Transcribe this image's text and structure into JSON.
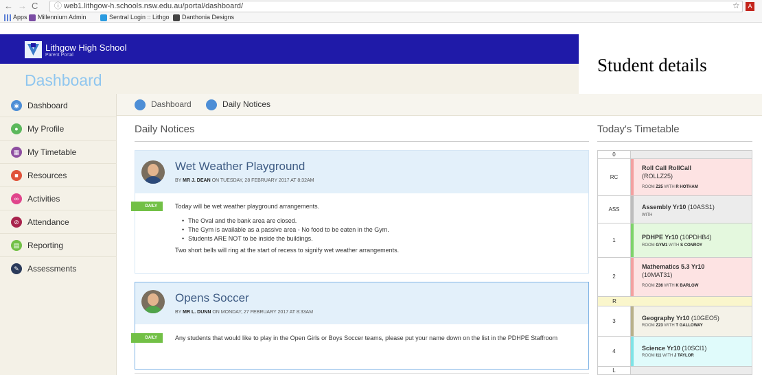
{
  "browser": {
    "url": "web1.lithgow-h.schools.nsw.edu.au/portal/dashboard/",
    "bookmarks": [
      "Apps",
      "Millennium Admin",
      "Sentral Login :: Lithgo",
      "Danthonia Designs"
    ]
  },
  "header": {
    "school": "Lithgow High School",
    "portal": "Parent Portal",
    "page_title": "Dashboard",
    "overlay_label": "Student details"
  },
  "sidebar": {
    "items": [
      {
        "label": "Dashboard",
        "color": "#4d8ed6"
      },
      {
        "label": "My Profile",
        "color": "#5cb85c"
      },
      {
        "label": "My Timetable",
        "color": "#8e4ea0"
      },
      {
        "label": "Resources",
        "color": "#e0533a"
      },
      {
        "label": "Activities",
        "color": "#e0458c"
      },
      {
        "label": "Attendance",
        "color": "#a8234c"
      },
      {
        "label": "Reporting",
        "color": "#72c046"
      },
      {
        "label": "Assessments",
        "color": "#2a3a5a"
      }
    ]
  },
  "breadcrumbs": [
    "Dashboard",
    "Daily Notices"
  ],
  "main": {
    "notices_title": "Daily Notices",
    "notices": [
      {
        "title": "Wet Weather Playground",
        "by_prefix": "BY",
        "author": "MR J. DEAN",
        "date": "ON TUESDAY, 28 FEBRUARY 2017 AT 8:32AM",
        "flag": "DAILY",
        "lead": "Today will be wet weather playground arrangements.",
        "bullets": [
          "The Oval and the bank area are closed.",
          "The Gym is available as a passive area - No food to be eaten in the Gym.",
          "Students ARE NOT to be inside the buildings."
        ],
        "tail": "Two short bells will ring at the start of recess to signify wet weather arrangements."
      },
      {
        "title": "Opens Soccer",
        "by_prefix": "BY",
        "author": "MR L. DUNN",
        "date": "ON MONDAY, 27 FEBRUARY 2017 AT 8:33AM",
        "flag": "DAILY",
        "lead": "Any students that would like to play in the Open Girls or Boys Soccer teams, please put your name down on the list in the PDHPE Staffroom"
      }
    ]
  },
  "timetable": {
    "title": "Today's Timetable",
    "rows": [
      {
        "period": "0"
      },
      {
        "period": "RC",
        "subject": "Roll Call RollCall",
        "code": "(ROLLZ25)",
        "room_prefix": "ROOM",
        "room": "Z25",
        "with": "WITH",
        "teacher": "R HOTHAM",
        "color": "#fde3e3",
        "bar": "#f3a0a0"
      },
      {
        "period": "ASS",
        "subject": "Assembly Yr10",
        "code": "(10ASS1)",
        "with": "WITH",
        "color": "#ececec",
        "bar": "#bdbdbd"
      },
      {
        "period": "1",
        "subject": "PDHPE Yr10",
        "code": "(10PDHB4)",
        "room_prefix": "ROOM",
        "room": "GYM1",
        "with": "WITH",
        "teacher": "S CONROY",
        "color": "#e4f8de",
        "bar": "#7ed36a"
      },
      {
        "period": "2",
        "subject": "Mathematics 5.3 Yr10",
        "code": "(10MAT31)",
        "room_prefix": "ROOM",
        "room": "Z36",
        "with": "WITH",
        "teacher": "K BARLOW",
        "color": "#fde3e3",
        "bar": "#f3a0a0"
      },
      {
        "period": "R"
      },
      {
        "period": "3",
        "subject": "Geography Yr10",
        "code": "(10GEO5)",
        "room_prefix": "ROOM",
        "room": "Z23",
        "with": "WITH",
        "teacher": "T GALLOWAY",
        "color": "#f4f2e8",
        "bar": "#b8b08a"
      },
      {
        "period": "4",
        "subject": "Science Yr10",
        "code": "(10SCI1)",
        "room_prefix": "ROOM",
        "room": "I11",
        "with": "WITH",
        "teacher": "J TAYLOR",
        "color": "#e0fbfb",
        "bar": "#7ee3e6"
      },
      {
        "period": "L"
      }
    ]
  }
}
